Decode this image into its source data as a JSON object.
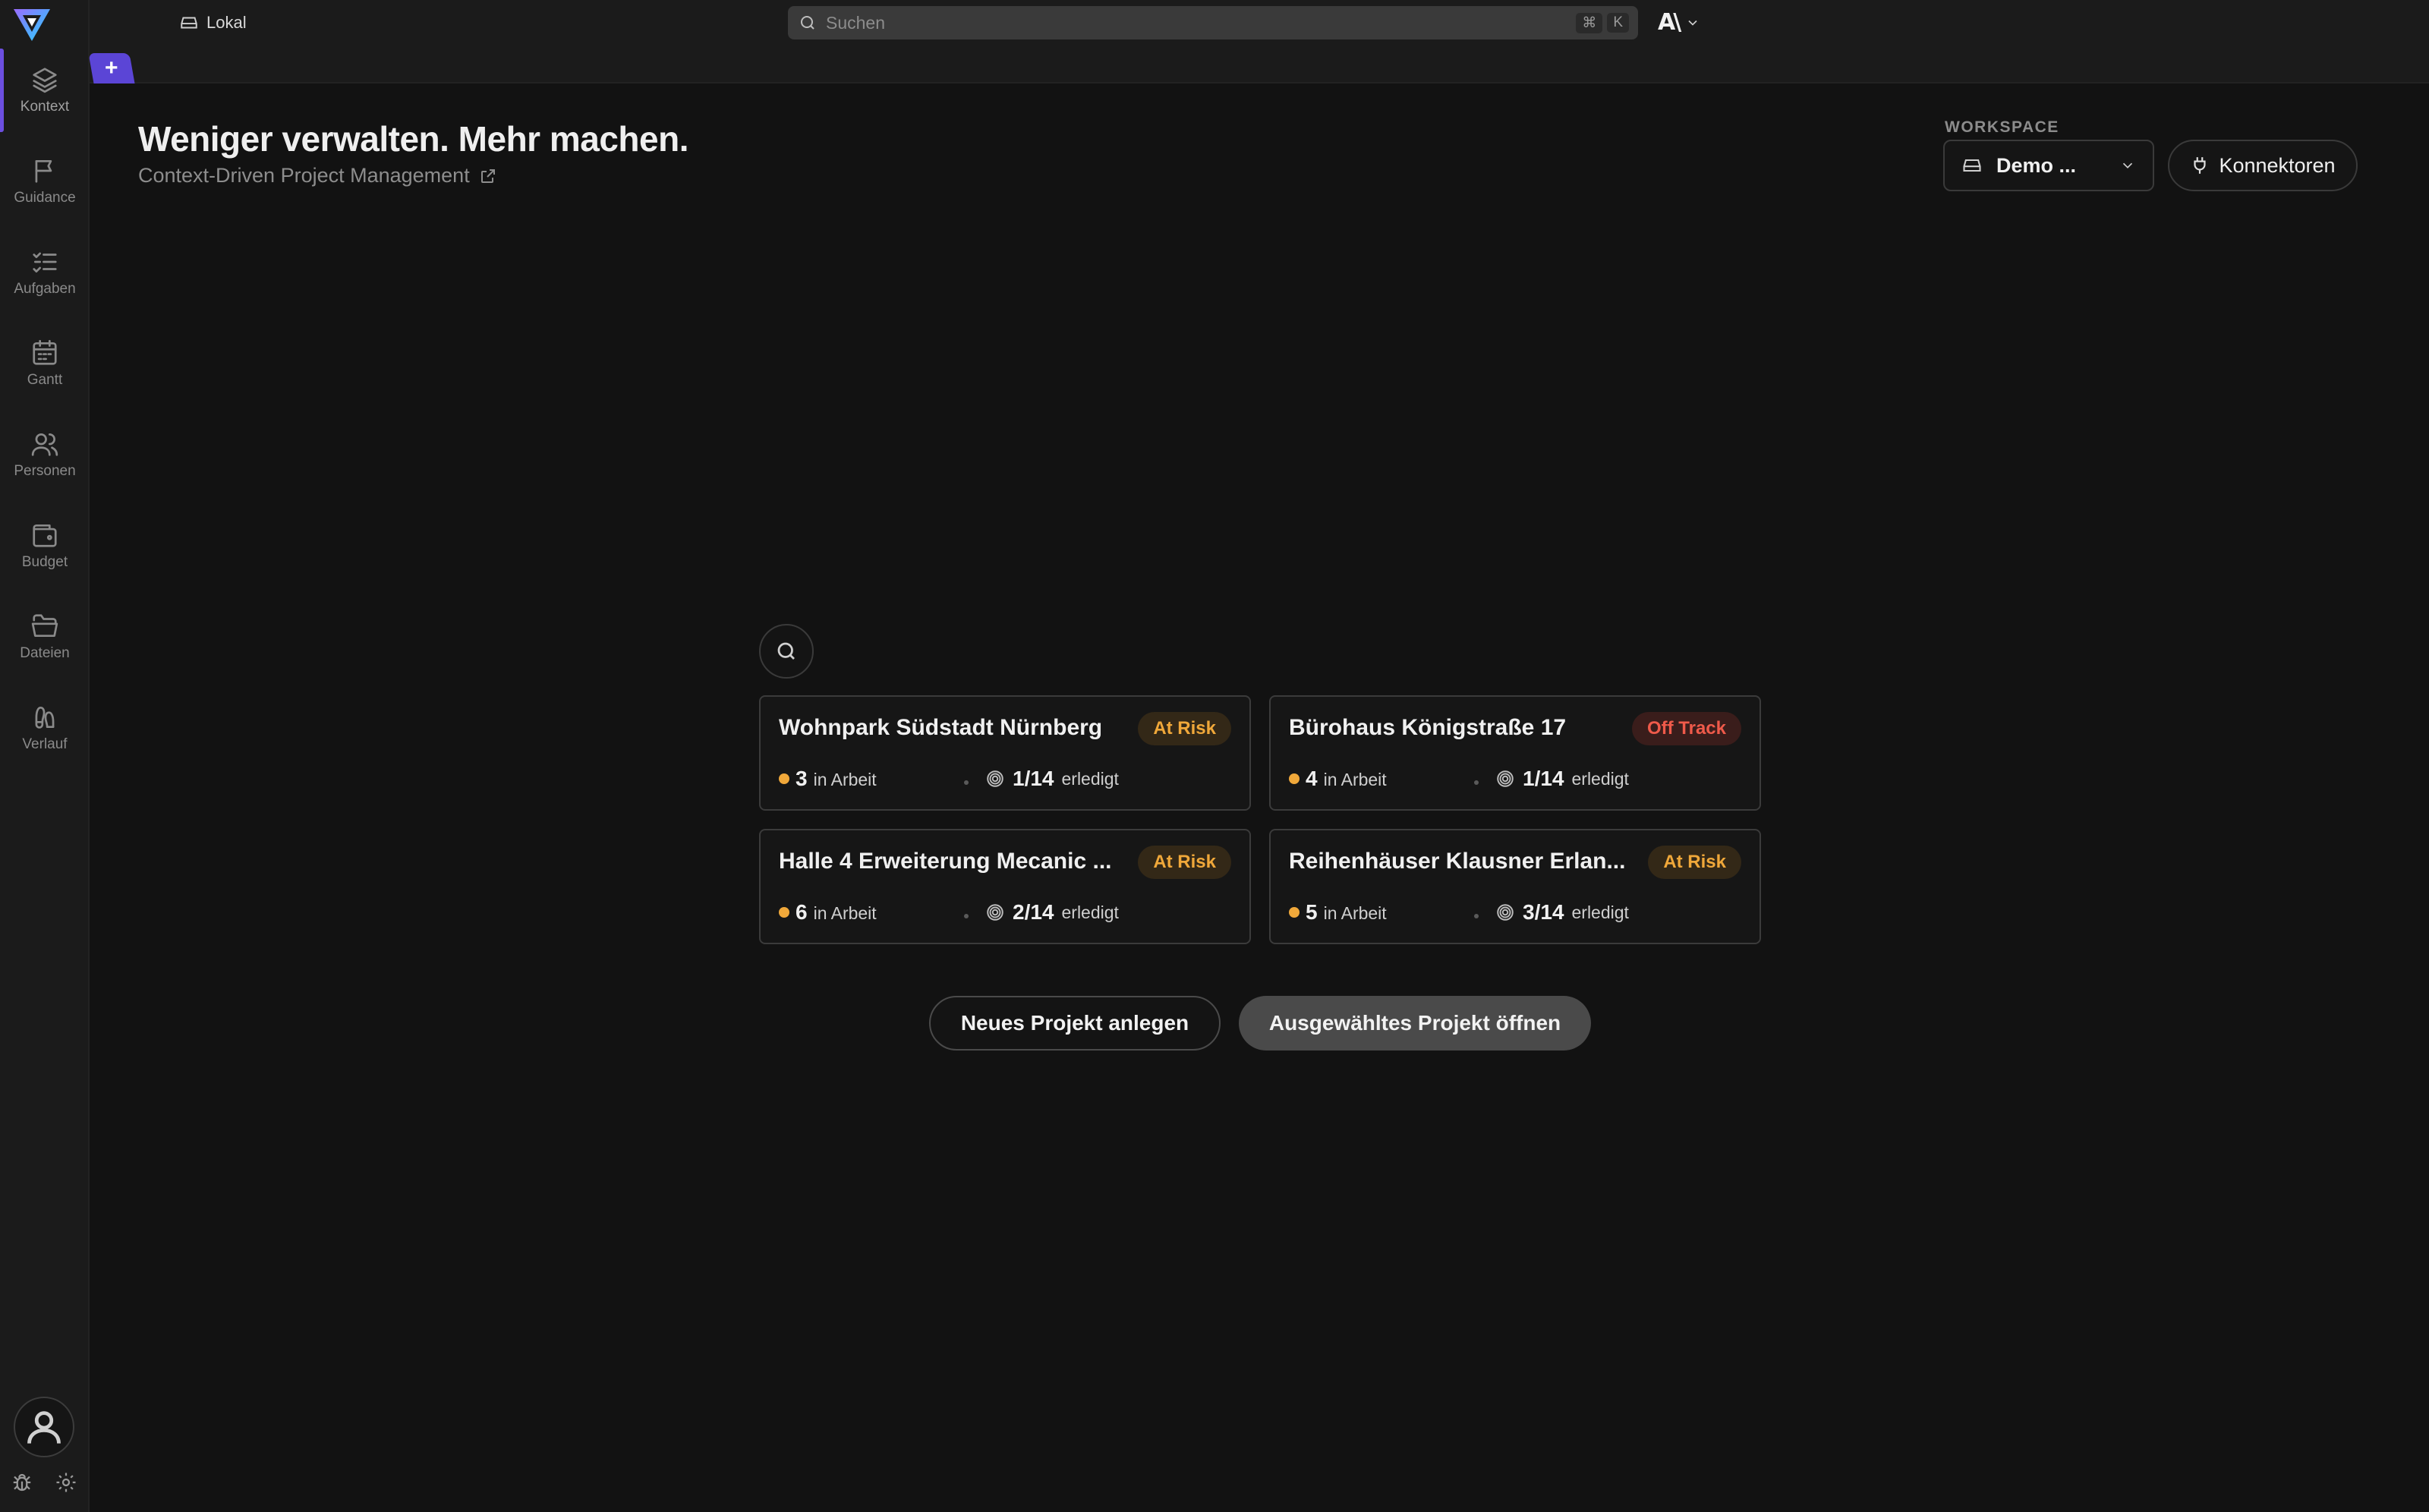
{
  "topbar": {
    "location_label": "Lokal",
    "search_placeholder": "Suchen",
    "shortcut_keys": [
      "⌘",
      "K"
    ],
    "brand_mark": "A\\"
  },
  "sidebar": {
    "items": [
      {
        "label": "Kontext",
        "icon": "layers-icon",
        "active": true
      },
      {
        "label": "Guidance",
        "icon": "flag-icon"
      },
      {
        "label": "Aufgaben",
        "icon": "list-check-icon"
      },
      {
        "label": "Gantt",
        "icon": "calendar-icon"
      },
      {
        "label": "Personen",
        "icon": "users-icon"
      },
      {
        "label": "Budget",
        "icon": "wallet-icon"
      },
      {
        "label": "Dateien",
        "icon": "folder-icon"
      },
      {
        "label": "Verlauf",
        "icon": "footprints-icon"
      }
    ]
  },
  "tabs": {
    "add_label": "+"
  },
  "header": {
    "title": "Weniger verwalten. Mehr machen.",
    "subtitle": "Context-Driven Project Management"
  },
  "workspace": {
    "label": "WORKSPACE",
    "selected": "Demo ...",
    "connectors_label": "Konnektoren"
  },
  "projects": [
    {
      "name": "Wohnpark Südstadt Nürnberg",
      "status": "At Risk",
      "in_progress": "3",
      "in_progress_label": "in Arbeit",
      "done": "1/14",
      "done_label": "erledigt"
    },
    {
      "name": "Bürohaus Königstraße 17",
      "status": "Off Track",
      "in_progress": "4",
      "in_progress_label": "in Arbeit",
      "done": "1/14",
      "done_label": "erledigt"
    },
    {
      "name": "Halle 4 Erweiterung Mecanic ...",
      "status": "At Risk",
      "in_progress": "6",
      "in_progress_label": "in Arbeit",
      "done": "2/14",
      "done_label": "erledigt"
    },
    {
      "name": "Reihenhäuser Klausner Erlan...",
      "status": "At Risk",
      "in_progress": "5",
      "in_progress_label": "in Arbeit",
      "done": "3/14",
      "done_label": "erledigt"
    }
  ],
  "actions": {
    "new_project": "Neues Projekt anlegen",
    "open_project": "Ausgewähltes Projekt öffnen"
  },
  "colors": {
    "accent": "#5b45d6",
    "at_risk": "#f0a83a",
    "off_track": "#ef5a4a"
  }
}
